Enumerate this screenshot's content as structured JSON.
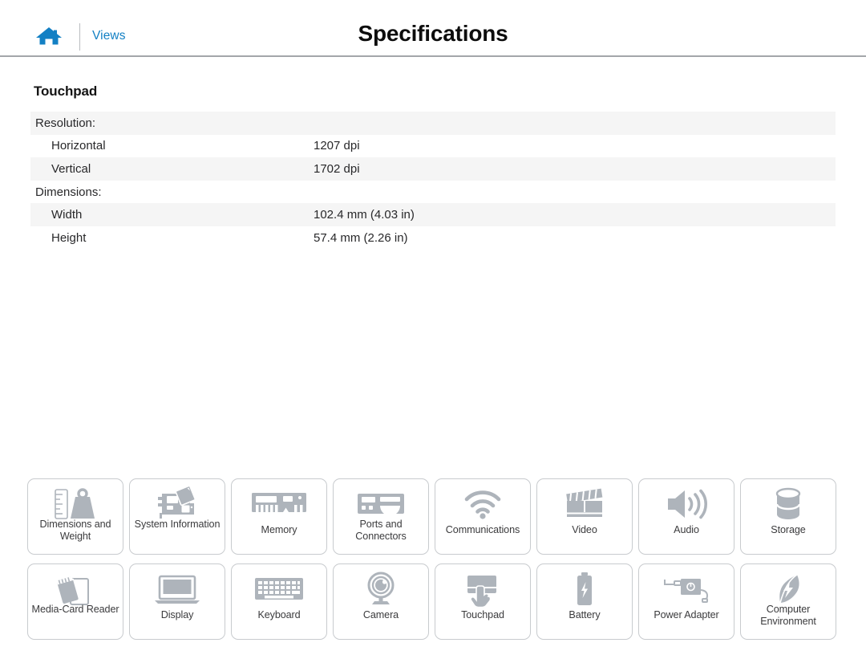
{
  "header": {
    "home_icon": "home-icon",
    "views_label": "Views",
    "title": "Specifications",
    "link_color": "#1380c4",
    "divider_color": "#a3a6aa"
  },
  "section": {
    "title": "Touchpad",
    "rows": [
      {
        "label": "Resolution:",
        "value": "",
        "type": "group",
        "shaded": true
      },
      {
        "label": "Horizontal",
        "value": "1207 dpi",
        "type": "sub",
        "shaded": false
      },
      {
        "label": "Vertical",
        "value": "1702 dpi",
        "type": "sub",
        "shaded": true
      },
      {
        "label": "Dimensions:",
        "value": "",
        "type": "group",
        "shaded": false
      },
      {
        "label": "Width",
        "value": "102.4 mm (4.03 in)",
        "type": "sub",
        "shaded": true
      },
      {
        "label": "Height",
        "value": "57.4 mm (2.26 in)",
        "type": "sub",
        "shaded": false
      }
    ],
    "row_shade_color": "#f5f5f5"
  },
  "tiles": {
    "icon_color": "#aeb4bb",
    "items": [
      {
        "label": "Dimensions and Weight",
        "icon": "ruler-weight-icon",
        "two_line": true
      },
      {
        "label": "System Information",
        "icon": "motherboard-icon",
        "two_line": true
      },
      {
        "label": "Memory",
        "icon": "memory-module-icon",
        "two_line": false
      },
      {
        "label": "Ports and Connectors",
        "icon": "ports-icon",
        "two_line": true
      },
      {
        "label": "Communications",
        "icon": "wifi-icon",
        "two_line": false
      },
      {
        "label": "Video",
        "icon": "clapperboard-icon",
        "two_line": false
      },
      {
        "label": "Audio",
        "icon": "speaker-icon",
        "two_line": false
      },
      {
        "label": "Storage",
        "icon": "drive-cylinder-icon",
        "two_line": false
      },
      {
        "label": "Media-Card Reader",
        "icon": "media-card-icon",
        "two_line": true
      },
      {
        "label": "Display",
        "icon": "laptop-display-icon",
        "two_line": false
      },
      {
        "label": "Keyboard",
        "icon": "keyboard-icon",
        "two_line": false
      },
      {
        "label": "Camera",
        "icon": "webcam-icon",
        "two_line": false
      },
      {
        "label": "Touchpad",
        "icon": "touchpad-hand-icon",
        "two_line": false
      },
      {
        "label": "Battery",
        "icon": "battery-icon",
        "two_line": false
      },
      {
        "label": "Power Adapter",
        "icon": "power-adapter-icon",
        "two_line": false
      },
      {
        "label": "Computer Environment",
        "icon": "leaf-bolt-icon",
        "two_line": true
      }
    ]
  }
}
